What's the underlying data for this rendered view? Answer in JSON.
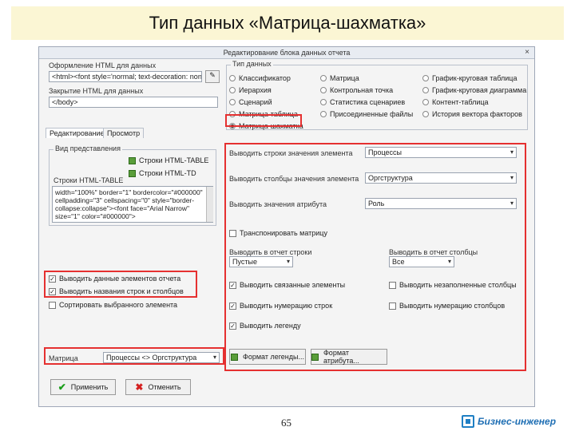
{
  "slide": {
    "title": "Тип данных «Матрица-шахматка»",
    "page_number": "65",
    "brand": "Бизнес-инженер"
  },
  "dialog": {
    "title": "Редактирование блока данных отчета",
    "close_symbol": "×",
    "header_text_label": "Оформление HTML для данных",
    "header_text_value": "<html><font style='normal; text-decoration: none'>",
    "footer_text_label": "Закрытие HTML для данных",
    "footer_text_value": "</body>",
    "edit_button": "✎",
    "type_group": "Тип данных",
    "types": [
      {
        "label": "Классификатор",
        "selected": false
      },
      {
        "label": "Матрица",
        "selected": false
      },
      {
        "label": "График-круговая таблица",
        "selected": false
      },
      {
        "label": "Иерархия",
        "selected": false
      },
      {
        "label": "Контрольная точка",
        "selected": false
      },
      {
        "label": "График-круговая диаграмма",
        "selected": false
      },
      {
        "label": "Сценарий",
        "selected": false
      },
      {
        "label": "Статистика сценариев",
        "selected": false
      },
      {
        "label": "Контент-таблица",
        "selected": false
      },
      {
        "label": "Матрица-таблица",
        "selected": false
      },
      {
        "label": "Присоединенные файлы",
        "selected": false
      },
      {
        "label": "История вектора факторов",
        "selected": false
      },
      {
        "label": "Матрица-шахматка",
        "selected": true
      }
    ],
    "tabs": [
      "Редактирование",
      "Просмотр"
    ],
    "left_group": "Вид представления",
    "string_table_btn1": "Строки HTML-TABLE",
    "string_table_btn2": "Строки HTML-TD",
    "table_label": "Строки HTML-TABLE",
    "table_code": "width=\"100%\" border=\"1\" bordercolor=\"#000000\"\ncellpadding=\"3\" cellspacing=\"0\" style=\"border-\ncollapse:collapse\"><font face=\"Arial Narrow\"\nsize=\"1\" color=\"#000000\">",
    "left_checks": [
      {
        "label": "Выводить данные элементов отчета",
        "checked": true
      },
      {
        "label": "Выводить названия строк и столбцов",
        "checked": true
      },
      {
        "label": "Сортировать выбранного элемента",
        "checked": false
      }
    ],
    "matrix_label": "Матрица",
    "matrix_value": "Процессы <> Оргструктура",
    "right": {
      "rows_label": "Выводить строки значения элемента",
      "rows_value": "Процессы",
      "cols_label": "Выводить столбцы значения элемента",
      "cols_value": "Оргструктура",
      "values_label": "Выводить значения атрибута",
      "values_value": "Роль",
      "transpose_label": "Транспонировать матрицу",
      "transpose_checked": false,
      "out_rows_label": "Выводить в отчет строки",
      "out_rows_value": "Пустые",
      "out_cols_label": "Выводить в отчет столбцы",
      "out_cols_value": "Все",
      "checks": [
        {
          "label": "Выводить связанные элементы",
          "checked": true
        },
        {
          "label": "Выводить незаполненные столбцы",
          "checked": false
        },
        {
          "label": "Выводить нумерацию строк",
          "checked": true
        },
        {
          "label": "Выводить нумерацию столбцов",
          "checked": false
        },
        {
          "label": "Выводить легенду",
          "checked": true
        }
      ],
      "legend_format_btn": "Формат легенды...",
      "attr_format_btn": "Формат атрибута..."
    },
    "apply_button": "Применить",
    "cancel_button": "Отменить"
  }
}
